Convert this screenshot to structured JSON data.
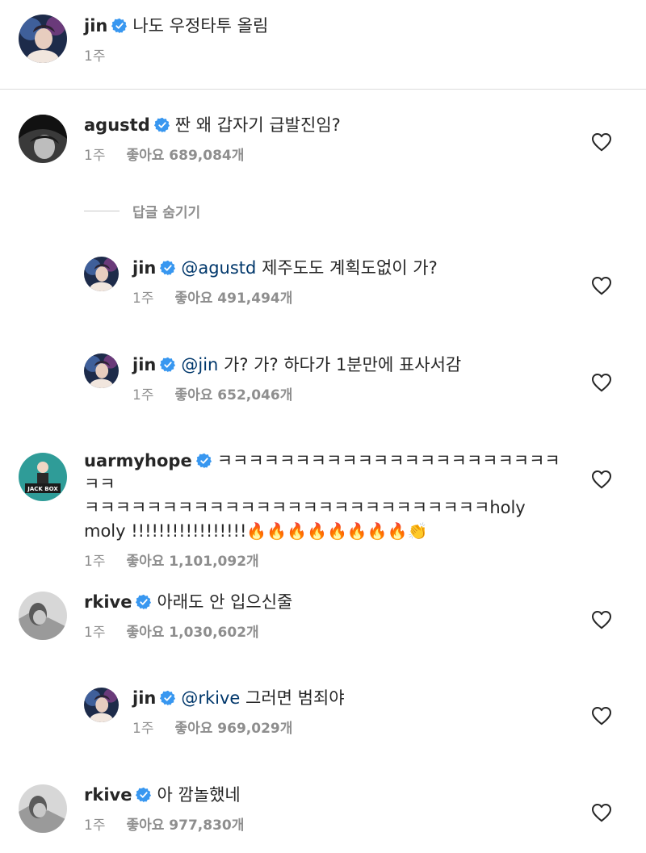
{
  "colors": {
    "verified_blue": "#3897f0",
    "meta_gray": "#8e8e8e",
    "mention_blue": "#00376b",
    "divider": "#dbdbdb"
  },
  "caption": {
    "username": "jin",
    "text": "나도 우정타투 올림",
    "time": "1주",
    "icons": [
      "avatar",
      "verified-badge-icon"
    ]
  },
  "hide_replies_label": "답글 숨기기",
  "comments": [
    {
      "username": "agustd",
      "mention": "",
      "text": "짠 왜 갑자기 급발진임?",
      "time": "1주",
      "likes": "좋아요 689,084개"
    },
    {
      "username": "jin",
      "mention": "@agustd",
      "text": "제주도도 계획도없이 가?",
      "time": "1주",
      "likes": "좋아요 491,494개"
    },
    {
      "username": "jin",
      "mention": "@jin",
      "text": "가? 가? 하다가 1분만에 표사서감",
      "time": "1주",
      "likes": "좋아요 652,046개"
    },
    {
      "username": "uarmyhope",
      "mention": "",
      "text_part1": "ㅋㅋㅋㅋㅋㅋㅋㅋㅋㅋㅋㅋㅋㅋㅋㅋㅋㅋㅋㅋㅋㅋㅋㅋ",
      "text_part2": "ㅋㅋㅋㅋㅋㅋㅋㅋㅋㅋㅋㅋㅋㅋㅋㅋㅋㅋㅋㅋㅋㅋㅋㅋㅋㅋholy",
      "text_part3": "moly !!!!!!!!!!!!!!!!!",
      "emojis": "🔥🔥🔥🔥🔥🔥🔥🔥👏",
      "time": "1주",
      "likes": "좋아요 1,101,092개"
    },
    {
      "username": "rkive",
      "mention": "",
      "text": "아래도 안 입으신줄",
      "time": "1주",
      "likes": "좋아요 1,030,602개"
    },
    {
      "username": "jin",
      "mention": "@rkive",
      "text": "그러면 범죄야",
      "time": "1주",
      "likes": "좋아요 969,029개"
    },
    {
      "username": "rkive",
      "mention": "",
      "text": "아 깜놀했네",
      "time": "1주",
      "likes": "좋아요 977,830개"
    }
  ]
}
